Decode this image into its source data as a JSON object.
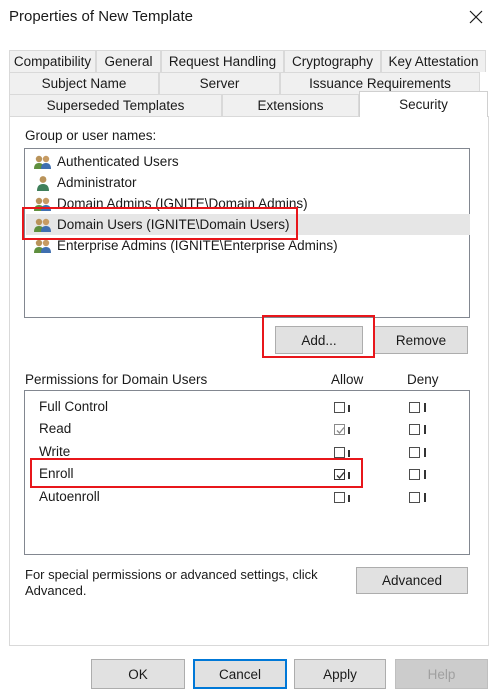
{
  "window": {
    "title": "Properties of New Template"
  },
  "tabs": {
    "row1": [
      "Compatibility",
      "General",
      "Request Handling",
      "Cryptography",
      "Key Attestation"
    ],
    "row2": [
      "Subject Name",
      "Server",
      "Issuance Requirements"
    ],
    "row3": [
      "Superseded Templates",
      "Extensions",
      "Security"
    ],
    "active": "Security"
  },
  "groups": {
    "label": "Group or user names:",
    "items": [
      {
        "label": "Authenticated Users",
        "icon": "users-group-icon"
      },
      {
        "label": "Administrator",
        "icon": "user-icon"
      },
      {
        "label": "Domain Admins (IGNITE\\Domain Admins)",
        "icon": "users-group-icon"
      },
      {
        "label": "Domain Users (IGNITE\\Domain Users)",
        "icon": "users-group-icon",
        "selected": true
      },
      {
        "label": "Enterprise Admins (IGNITE\\Enterprise Admins)",
        "icon": "users-group-icon"
      }
    ]
  },
  "buttons": {
    "add": "Add...",
    "remove": "Remove",
    "advanced": "Advanced",
    "ok": "OK",
    "cancel": "Cancel",
    "apply": "Apply",
    "help": "Help"
  },
  "permissions": {
    "label": "Permissions for Domain Users",
    "allow_header": "Allow",
    "deny_header": "Deny",
    "rows": [
      {
        "name": "Full Control",
        "allow": false,
        "deny": false
      },
      {
        "name": "Read",
        "allow": true,
        "deny": false,
        "allow_disabled": true
      },
      {
        "name": "Write",
        "allow": false,
        "deny": false
      },
      {
        "name": "Enroll",
        "allow": true,
        "deny": false
      },
      {
        "name": "Autoenroll",
        "allow": false,
        "deny": false
      }
    ]
  },
  "advanced_note": {
    "line1": "For special permissions or advanced settings, click",
    "line2": "Advanced."
  },
  "colors": {
    "highlight_red": "#e8161b",
    "accent_blue": "#0078d7",
    "selection": "#e6e6e6"
  }
}
